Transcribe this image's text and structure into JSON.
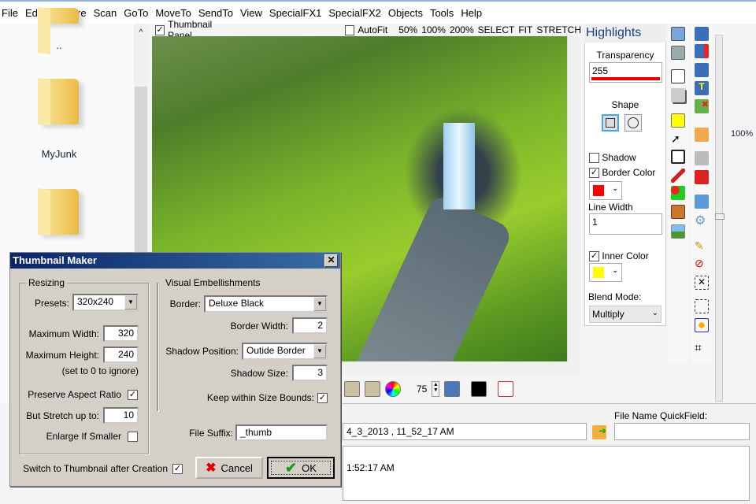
{
  "menu": [
    "File",
    "Edit",
    "Capture",
    "Scan",
    "GoTo",
    "MoveTo",
    "SendTo",
    "View",
    "SpecialFX1",
    "SpecialFX2",
    "Objects",
    "Tools",
    "Help"
  ],
  "browser": {
    "items": [
      "..",
      "MyJunk"
    ]
  },
  "imagePanel": {
    "thumbnail_panel": "Thumbnail Panel",
    "autofit": "AutoFit",
    "zoom_options": [
      "50%",
      "100%",
      "200%",
      "SELECT",
      "FIT",
      "STRETCH"
    ]
  },
  "toolbar": {
    "quality": "75"
  },
  "highlights": {
    "title": "Highlights",
    "transparency_label": "Transparency",
    "transparency": "255",
    "shape_label": "Shape",
    "shadow": "Shadow",
    "border_color": "Border Color",
    "border_color_value": "#ff0000",
    "line_width_label": "Line Width",
    "line_width": "1",
    "inner_color": "Inner Color",
    "inner_color_value": "#ffff00",
    "blend_label": "Blend Mode:",
    "blend_mode": "Multiply"
  },
  "zoom_level": "100%",
  "bottom": {
    "quickfield_label": "File Name QuickField:",
    "filename": "4_3_2013 , 11_52_17 AM",
    "quickfield": "",
    "comment": "1:52:17 AM"
  },
  "dialog": {
    "title": "Thumbnail Maker",
    "resizing": "Resizing",
    "presets_label": "Presets:",
    "preset": "320x240",
    "max_width_label": "Maximum Width:",
    "max_width": "320",
    "max_height_label": "Maximum Height:",
    "max_height": "240",
    "ignore_hint": "(set to 0 to ignore)",
    "preserve": "Preserve Aspect Ratio",
    "stretch_label": "But Stretch up to:",
    "stretch": "10",
    "enlarge": "Enlarge If Smaller",
    "visual": "Visual Embellishments",
    "border_label": "Border:",
    "border": "Deluxe Black",
    "border_width_label": "Border Width:",
    "border_width": "2",
    "shadow_pos_label": "Shadow Position:",
    "shadow_pos": "Outide Border",
    "shadow_size_label": "Shadow Size:",
    "shadow_size": "3",
    "keep_bounds": "Keep within Size Bounds:",
    "suffix_label": "File Suffix:",
    "suffix": "_thumb",
    "switch_after": "Switch to Thumbnail after Creation",
    "cancel": "Cancel",
    "ok": "OK"
  }
}
